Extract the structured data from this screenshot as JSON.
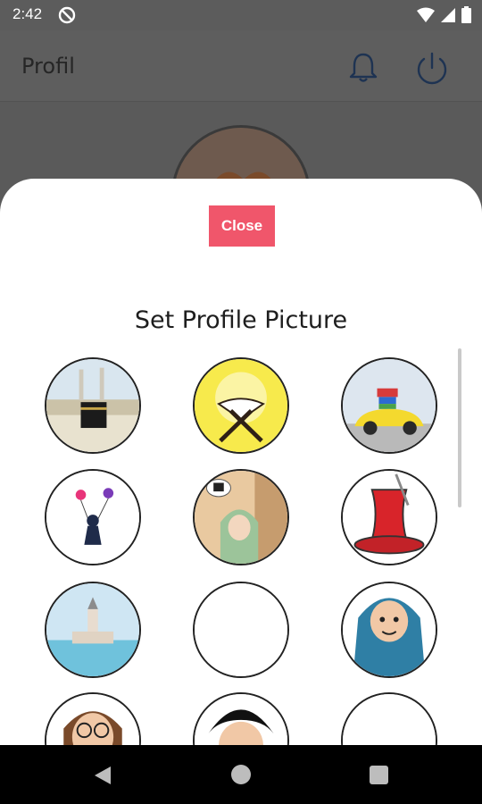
{
  "status_bar": {
    "time": "2:42"
  },
  "app_bar": {
    "title": "Profil"
  },
  "sheet": {
    "close_label": "Close",
    "title": "Set Profile Picture"
  },
  "pictures": [
    {
      "name": "kaaba"
    },
    {
      "name": "quran-light"
    },
    {
      "name": "yellow-car-luggage"
    },
    {
      "name": "girl-balloons"
    },
    {
      "name": "girl-hijab-thinking"
    },
    {
      "name": "turkish-tea"
    },
    {
      "name": "maiden-tower"
    },
    {
      "name": "empty"
    },
    {
      "name": "hijab-woman"
    },
    {
      "name": "man-glasses"
    },
    {
      "name": "boy-black-hair"
    },
    {
      "name": "empty-2"
    }
  ],
  "colors": {
    "close_button": "#f0566b",
    "sheet": "#ffffff",
    "overlay": "#5a5a5a"
  }
}
